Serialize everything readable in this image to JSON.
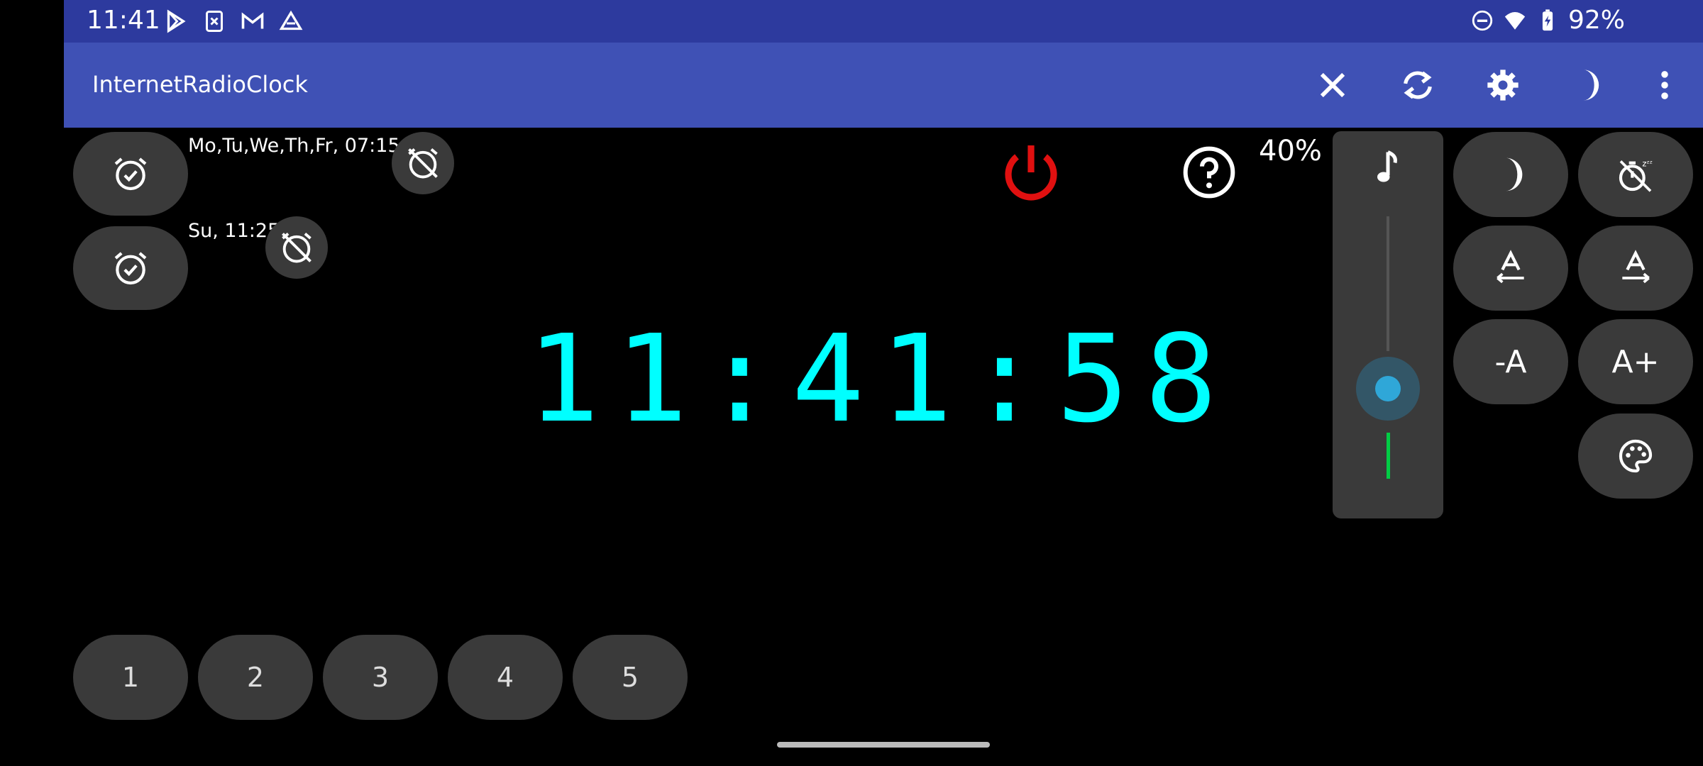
{
  "status_bar": {
    "time": "11:41",
    "battery": "92%",
    "left_icons": [
      "play-store-icon",
      "file-x-icon",
      "gmail-icon",
      "drive-icon"
    ],
    "right_icons": [
      "do-not-disturb-icon",
      "wifi-icon",
      "battery-icon"
    ]
  },
  "app_bar": {
    "title": "InternetRadioClock",
    "actions": [
      "close-icon",
      "sync-icon",
      "settings-icon",
      "night-mode-icon",
      "more-vert-icon"
    ]
  },
  "alarms": [
    {
      "label": "Mo,Tu,We,Th,Fr, 07:15"
    },
    {
      "label": "Su, 11:25"
    }
  ],
  "clock": {
    "time": "11:41:58",
    "color": "#00ffff"
  },
  "volume": {
    "percent_label": "40%",
    "level_percent": 40
  },
  "presets": [
    "1",
    "2",
    "3",
    "4",
    "5"
  ],
  "font_buttons": {
    "decrease": "-A",
    "increase": "A+"
  },
  "colors": {
    "status_bar": "#2d3a9e",
    "app_bar": "#3f51b5",
    "power": "#e01010",
    "button_bg": "#3a3a3a",
    "knob": "#2fa7d8",
    "level": "#00cc44"
  }
}
